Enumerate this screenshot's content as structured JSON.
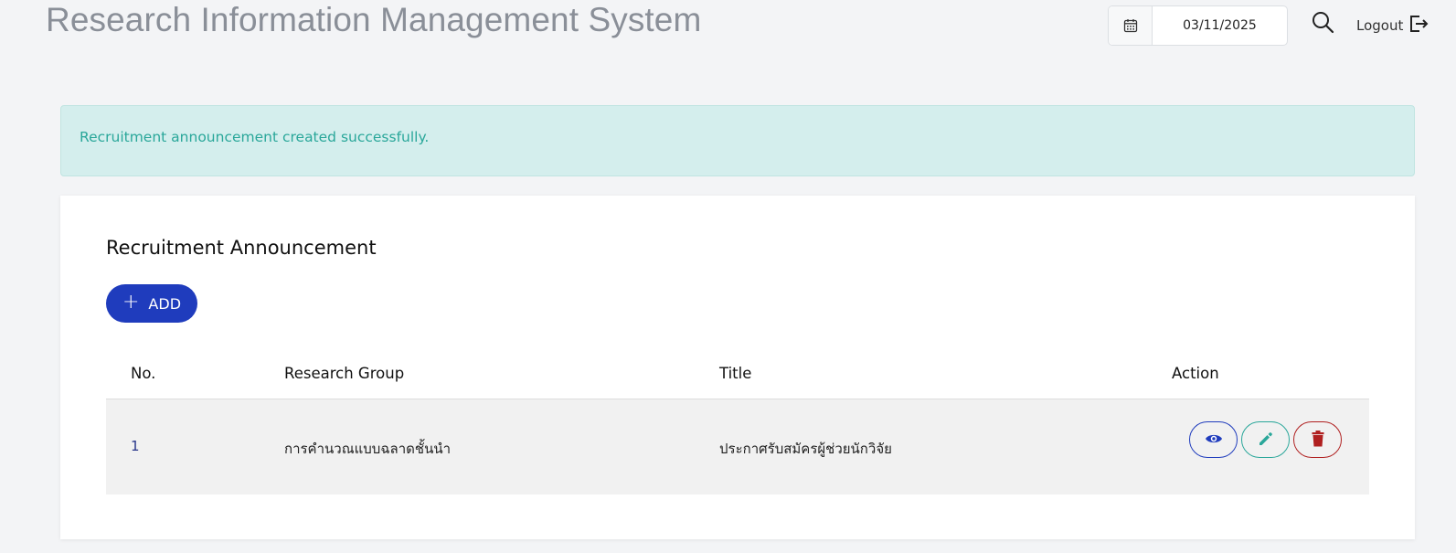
{
  "header": {
    "title": "Research Information Management System",
    "date_value": "03/11/2025",
    "logout_label": "Logout"
  },
  "alert": {
    "message": "Recruitment announcement created successfully."
  },
  "section": {
    "title": "Recruitment Announcement",
    "add_label": "ADD"
  },
  "table": {
    "columns": [
      "No.",
      "Research Group",
      "Title",
      "Action"
    ],
    "rows": [
      {
        "no": "1",
        "research_group": "การคำนวณแบบฉลาดชั้นนำ",
        "title": "ประกาศรับสมัครผู้ช่วยนักวิจัย"
      }
    ]
  },
  "icons": {
    "calendar": "calendar-icon",
    "search": "search-icon",
    "logout": "logout-icon",
    "plus": "plus-icon",
    "view": "eye-icon",
    "edit": "pencil-icon",
    "delete": "trash-icon"
  },
  "colors": {
    "primary": "#1f3cbd",
    "success_text": "#2aa79a",
    "success_bg": "#d4eeed",
    "danger": "#b02020",
    "title_gray": "#8a8f98"
  }
}
